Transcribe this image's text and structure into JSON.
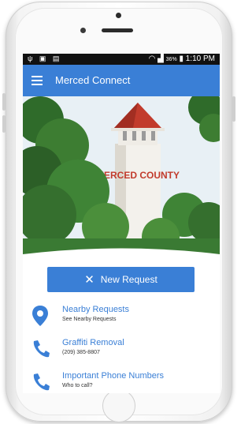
{
  "status_bar": {
    "battery": "36%",
    "time": "1:10 PM"
  },
  "app_bar": {
    "title": "Merced Connect"
  },
  "hero": {
    "tower_sign": "MERCED COUNTY"
  },
  "actions": {
    "new_request_label": "New Request"
  },
  "list": [
    {
      "icon": "map-pin-icon",
      "title": "Nearby Requests",
      "subtitle": "See Nearby Requests"
    },
    {
      "icon": "phone-icon",
      "title": "Graffiti Removal",
      "subtitle": "(209) 385-8807"
    },
    {
      "icon": "phone-icon",
      "title": "Important Phone Numbers",
      "subtitle": "Who to call?"
    }
  ],
  "colors": {
    "primary": "#3a7fd6",
    "status_bar": "#111111",
    "tower_roof": "#c23b2c"
  }
}
